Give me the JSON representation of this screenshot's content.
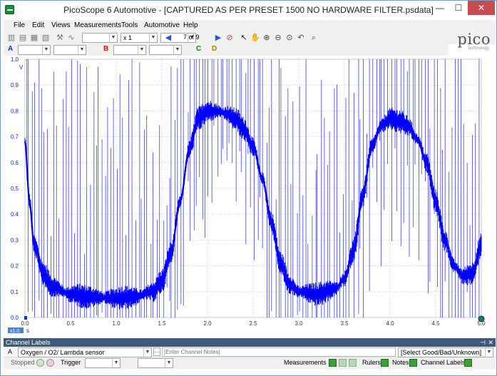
{
  "window": {
    "title": "PicoScope 6 Automotive - [CAPTURED AS PER PRESET 1500 NO HARDWARE FILTER.psdata]",
    "min_glyph": "—",
    "max_glyph": "☐",
    "close_glyph": "✕"
  },
  "menu": [
    "File",
    "Edit",
    "Views",
    "Measurements",
    "Tools",
    "Automotive",
    "Help"
  ],
  "toolbar": {
    "zoom_value": "x 1",
    "buffer_position": "7 of 9",
    "timebase_value": "",
    "samples_value": ""
  },
  "logo": {
    "word": "pico",
    "tagline": "Technology"
  },
  "channel_bar": {
    "channel_a": "A",
    "channel_b": "B",
    "channel_c": "C",
    "channel_d": "D"
  },
  "chart_data": {
    "type": "line",
    "title": "",
    "xlabel": "s",
    "ylabel": "V",
    "xlim": [
      0,
      5.0
    ],
    "ylim": [
      0,
      1.0
    ],
    "x_ticks": [
      "0.0",
      "0.5",
      "1.0",
      "1.5",
      "2.0",
      "2.5",
      "3.0",
      "3.5",
      "4.0",
      "4.5",
      "5.0"
    ],
    "y_ticks": [
      "0.0",
      "0.1",
      "0.2",
      "0.3",
      "0.4",
      "0.5",
      "0.6",
      "0.7",
      "0.8",
      "0.9",
      "1.0"
    ],
    "grid": true,
    "series_color": "#0000ff",
    "zoom_badge": "x1.0",
    "series": [
      {
        "x": [
          0.0,
          0.05,
          0.1,
          0.2,
          0.3,
          0.5,
          0.7,
          1.0,
          1.2,
          1.4,
          1.5,
          1.6,
          1.7,
          1.8,
          1.9,
          2.0,
          2.1,
          2.2,
          2.3,
          2.4,
          2.5,
          2.6,
          2.7,
          2.8,
          2.9,
          3.0,
          3.2,
          3.4,
          3.5,
          3.6,
          3.7,
          3.8,
          3.9,
          4.0,
          4.1,
          4.2,
          4.3,
          4.4,
          4.5,
          4.6,
          4.7,
          4.8,
          4.9,
          5.0
        ],
        "values": [
          0.68,
          0.45,
          0.28,
          0.17,
          0.12,
          0.09,
          0.08,
          0.075,
          0.08,
          0.1,
          0.14,
          0.25,
          0.45,
          0.65,
          0.77,
          0.8,
          0.8,
          0.79,
          0.77,
          0.73,
          0.66,
          0.54,
          0.37,
          0.21,
          0.13,
          0.1,
          0.09,
          0.11,
          0.15,
          0.26,
          0.47,
          0.66,
          0.74,
          0.77,
          0.76,
          0.74,
          0.69,
          0.6,
          0.45,
          0.3,
          0.2,
          0.16,
          0.17,
          0.28
        ]
      }
    ]
  },
  "channel_labels_panel": {
    "title": "Channel Labels",
    "pin_glyph": "⊣",
    "close_glyph": "✕",
    "row": {
      "channel": "A",
      "label": "Oxygen / O2/ Lambda sensor",
      "notes_placeholder": "[Enter Channel Notes]",
      "status": "[Select Good/Bad/Unknown]"
    }
  },
  "statusbar": {
    "state": "Stopped",
    "trigger": "Trigger",
    "measurements": "Measurements",
    "rulers": "Rulers",
    "notes": "Notes",
    "channel_labels": "Channel Labels"
  }
}
